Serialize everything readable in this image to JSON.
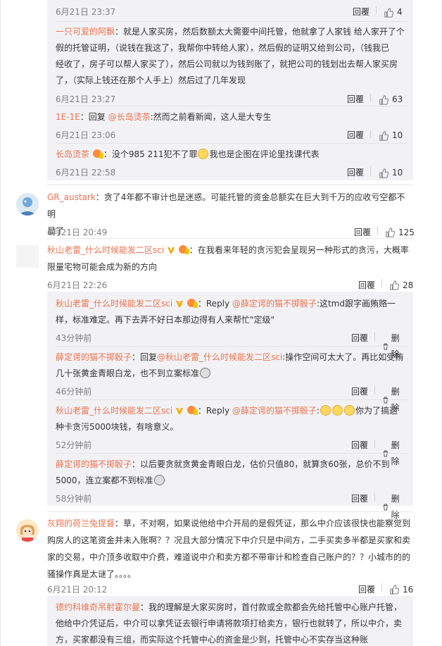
{
  "common": {
    "reply_label": "回覆"
  },
  "c0": {
    "time": "6月21日 23:37",
    "likes": "4"
  },
  "c1": {
    "name": "一只可爱的阿飘",
    "line1": "：就是人家买房，然后数额太大需要中间托管，他就拿了人家钱 给人家开了个",
    "line2": "假的托管证明，（说钱在我这了，我帮你中转给人家），然后假的证明又给到公司，（钱我已",
    "line3": "经收了，房子可以帮人家买了），然后公司就以为钱到账了，就把公司的钱划出去帮人家买房",
    "line4": "了，（实际上钱还在那个人手上）然后过了几年发现",
    "time": "6月21日 23:27",
    "likes": "63"
  },
  "c2": {
    "name": "1E-1E",
    "prefix": "：回复 ",
    "mention": "@长岛烫茶",
    "text": ":然而之前看新闻，这人是大专生",
    "time": "6月21日 23:06",
    "likes": "10"
  },
  "c3": {
    "name": "长岛烫茶",
    "text_a": "：没个985 211犯不了罪",
    "text_b": "我也是企图在评论里找课代表",
    "time": "6月21日 22:58",
    "likes": "10"
  },
  "m1": {
    "name": "GR_austark",
    "line1": "：贪了4年都不审计也是迷惑。可能托管的资金总额实在巨大到千万的应收亏空都不明",
    "line2": "显了",
    "time": "6月21日 20:49",
    "likes": "125"
  },
  "m2": {
    "name": "秋山老雷_什么时候能发二区sci",
    "line1": "：在我看来年轻的贪污犯会呈现另一种形式的贪污，大概率",
    "line2": "限量宅物可能会成为新的方向",
    "time": "6月21日 22:26",
    "likes": "28"
  },
  "s1": {
    "name": "秋山老雷_什么时候能发二区sci",
    "prefix": "：Reply ",
    "mention": "@薛定谔的猫不掷骰子",
    "line1_tail": ":这tmd跟字画贿赂一",
    "line2": "样，标准难定。再下去弄不好日本那边得有人来帮忙\"定级\"",
    "time": "43分钟前"
  },
  "s2": {
    "name": "薛定谔的猫不掷骰子",
    "prefix": "：回复",
    "mention": "@秋山老雷_什么时候能发二区sci",
    "line1_tail": ":操作空间可太大了。再比如受贿",
    "line2": "几十张黄金青眼白龙，也不到立案标准",
    "time": "46分钟前"
  },
  "s3": {
    "name": "秋山老雷_什么时候能发二区sci",
    "prefix": "：Reply ",
    "mention": "@薛定谔的猫不掷骰子",
    "line1_tail": "你为了搞这",
    "line2": "种卡贪污5000块钱，有啥意义。",
    "time": "52分钟前"
  },
  "s4": {
    "name": "薛定谔的猫不掷骰子",
    "line1": "：以后要贪就贪黄金青眼白龙，估价只值80，就算贪60张，总价不到",
    "line2": "5000，连立案都不到标准",
    "time": "58分钟前"
  },
  "delete_label": "删除",
  "m3": {
    "name": "灰翔的荷兰兔提督",
    "line1": "：草，不对啊，如果说他给中介开局的是假凭证，那么中介应该很快也能察觉到",
    "line2": "购房人的这笔资金并未入账啊？？况且大部分情况下中介只是中间方，二手买卖多半都是买家和卖",
    "line3": "家的交易，中介顶多收取中介费，难道说中介和卖方都不带审计和检查自己账户的？？小城市的的",
    "line4": "骚操作真是太谜了。。。。",
    "time": "6月21日 20:12",
    "likes": "16"
  },
  "s5": {
    "name": "德约科维奇吊射霍尔曼",
    "line1": "：我的理解是大家买房时，首付款或全款都会先给托管中心账户托管，",
    "line2": "他给中介凭证后，中介可以拿凭证去银行申请将款项打给卖方，银行也就转了，所以中介，卖",
    "line3": "方，买家都没有三组，而实际这个托管中心的资金是少到，托管中心不实存当这种账"
  },
  "colors": {
    "accent": "#eb7350",
    "like": "#808080",
    "vip": "#f7a900"
  }
}
